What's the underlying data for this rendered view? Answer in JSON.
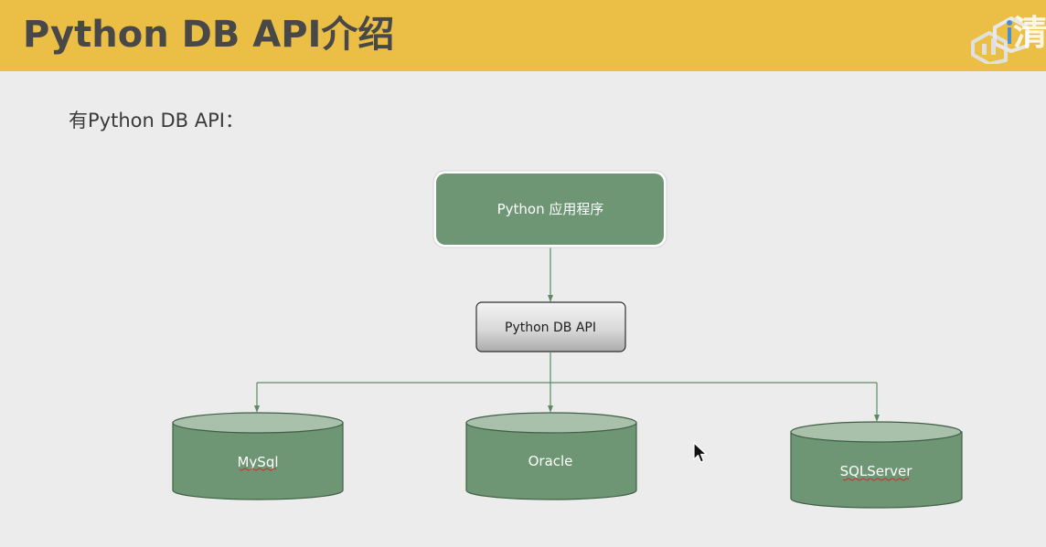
{
  "slide": {
    "title": "Python DB API介绍",
    "logo_text": "清"
  },
  "intro": {
    "text": "有Python DB API："
  },
  "diagram": {
    "top_node": "Python 应用程序",
    "middle_node": "Python DB API",
    "databases": [
      "MySql",
      "Oracle",
      "SQLServer"
    ]
  },
  "colors": {
    "header": "#ebbf45",
    "background": "#ececec",
    "node_green": "#6e9674",
    "connector": "#5d8a66",
    "api_box_top": "#f2f2f2",
    "api_box_bottom": "#b5b5b5"
  }
}
